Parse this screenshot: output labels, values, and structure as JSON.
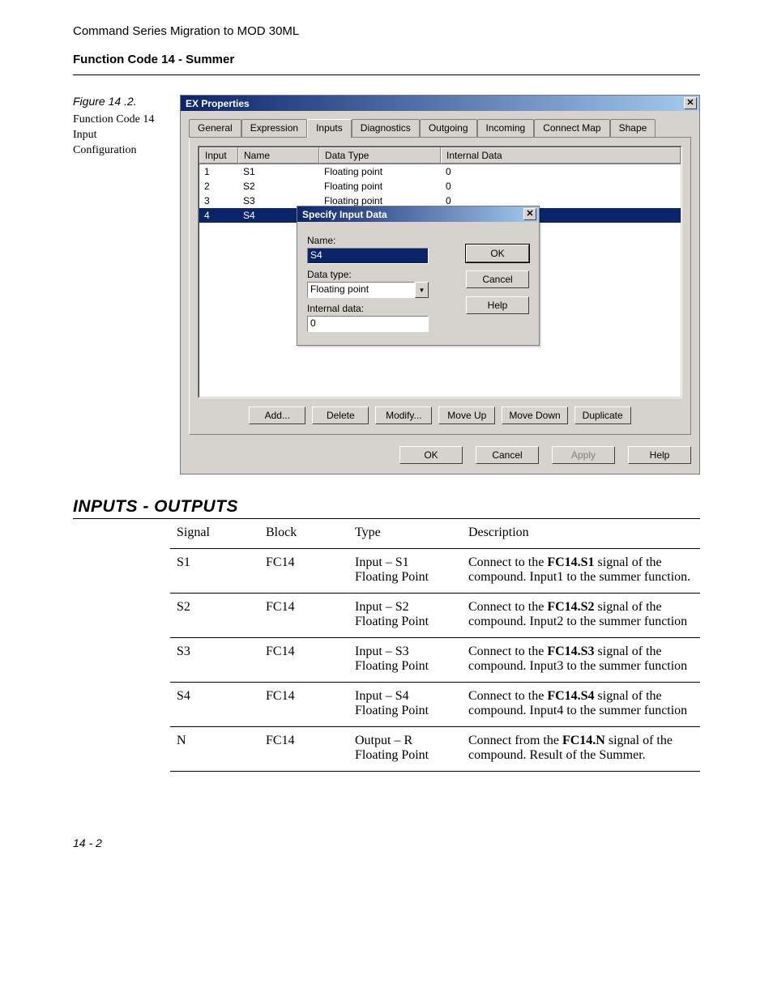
{
  "header": {
    "title": "Command Series Migration to MOD 30ML",
    "subtitle": "Function Code 14 - Summer"
  },
  "figure": {
    "label": "Figure 14 .2.",
    "caption_line1": "Function Code 14",
    "caption_line2": "Input Configuration"
  },
  "dialog": {
    "title": "EX Properties",
    "tabs": [
      "General",
      "Expression",
      "Inputs",
      "Diagnostics",
      "Outgoing",
      "Incoming",
      "Connect Map",
      "Shape"
    ],
    "active_tab_index": 2,
    "list_headers": {
      "input": "Input",
      "name": "Name",
      "data_type": "Data Type",
      "internal_data": "Internal Data"
    },
    "rows": [
      {
        "input": "1",
        "name": "S1",
        "data_type": "Floating point",
        "internal_data": "0",
        "selected": false
      },
      {
        "input": "2",
        "name": "S2",
        "data_type": "Floating point",
        "internal_data": "0",
        "selected": false
      },
      {
        "input": "3",
        "name": "S3",
        "data_type": "Floating point",
        "internal_data": "0",
        "selected": false
      },
      {
        "input": "4",
        "name": "S4",
        "data_type": "",
        "internal_data": "",
        "selected": true
      }
    ],
    "panel_buttons": {
      "add": "Add...",
      "delete": "Delete",
      "modify": "Modify...",
      "move_up": "Move Up",
      "move_down": "Move Down",
      "duplicate": "Duplicate"
    },
    "bottom_buttons": {
      "ok": "OK",
      "cancel": "Cancel",
      "apply": "Apply",
      "help": "Help"
    }
  },
  "modal": {
    "title": "Specify Input Data",
    "labels": {
      "name": "Name:",
      "data_type": "Data type:",
      "internal_data": "Internal data:"
    },
    "values": {
      "name": "S4",
      "data_type": "Floating point",
      "internal_data": "0"
    },
    "buttons": {
      "ok": "OK",
      "cancel": "Cancel",
      "help": "Help"
    }
  },
  "section": {
    "heading": "INPUTS - OUTPUTS"
  },
  "io_table": {
    "headers": {
      "signal": "Signal",
      "block": "Block",
      "type": "Type",
      "description": "Description"
    },
    "rows": [
      {
        "signal": "S1",
        "block": "FC14",
        "type_l1": "Input – S1",
        "type_l2": "Floating Point",
        "desc_pre": "Connect to the ",
        "desc_bold": "FC14.S1",
        "desc_post": " signal of the compound. Input1 to the summer function."
      },
      {
        "signal": "S2",
        "block": "FC14",
        "type_l1": "Input – S2",
        "type_l2": "Floating Point",
        "desc_pre": "Connect to the ",
        "desc_bold": "FC14.S2",
        "desc_post": " signal of the compound. Input2 to the summer function"
      },
      {
        "signal": "S3",
        "block": "FC14",
        "type_l1": "Input –  S3",
        "type_l2": "Floating Point",
        "desc_pre": "Connect to the ",
        "desc_bold": "FC14.S3",
        "desc_post": " signal of the compound. Input3 to the summer function"
      },
      {
        "signal": "S4",
        "block": "FC14",
        "type_l1": "Input –  S4",
        "type_l2": "Floating Point",
        "desc_pre": "Connect to the ",
        "desc_bold": "FC14.S4",
        "desc_post": " signal of the compound. Input4 to the summer function"
      },
      {
        "signal": "N",
        "block": "FC14",
        "type_l1": "Output – R",
        "type_l2": "Floating Point",
        "desc_pre": "Connect from the ",
        "desc_bold": "FC14.N",
        "desc_post": " signal of the compound. Result of the Summer."
      }
    ]
  },
  "footer": {
    "page": "14 - 2"
  }
}
